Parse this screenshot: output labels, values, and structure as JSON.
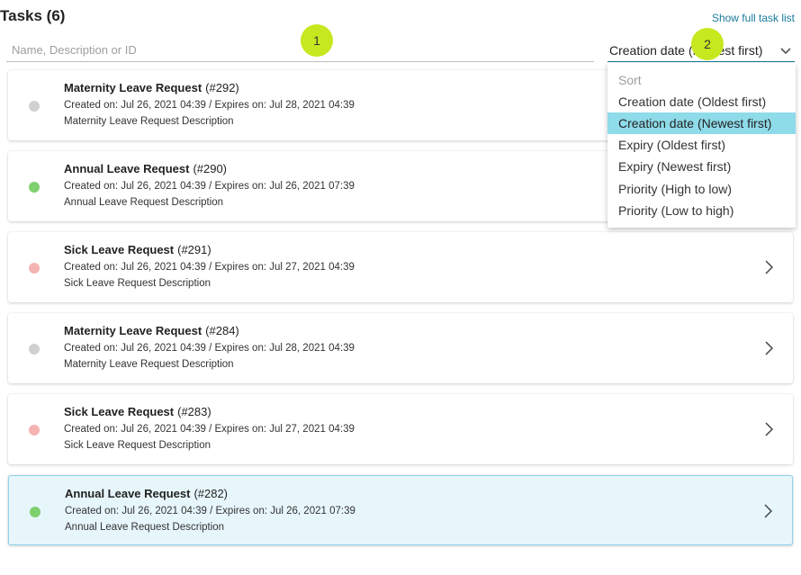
{
  "header": {
    "title": "Tasks (6)",
    "show_full_link": "Show full task list"
  },
  "search": {
    "placeholder": "Name, Description or ID",
    "value": ""
  },
  "sort": {
    "selected_label": "Creation date (Newest first)",
    "header": "Sort",
    "options": [
      "Creation date (Oldest first)",
      "Creation date (Newest first)",
      "Expiry (Oldest first)",
      "Expiry (Newest first)",
      "Priority (High to low)",
      "Priority (Low to high)"
    ],
    "active_index": 1
  },
  "markers": [
    "1",
    "2"
  ],
  "tasks": [
    {
      "name": "Maternity Leave Request",
      "id": "(#292)",
      "dates": "Created on: Jul 26, 2021 04:39 / Expires on: Jul 28, 2021 04:39",
      "description": "Maternity Leave Request Description",
      "status_color": "#d0d0d0"
    },
    {
      "name": "Annual Leave Request",
      "id": "(#290)",
      "dates": "Created on: Jul 26, 2021 04:39 / Expires on: Jul 26, 2021 07:39",
      "description": "Annual Leave Request Description",
      "status_color": "#7fd06e"
    },
    {
      "name": "Sick Leave Request",
      "id": "(#291)",
      "dates": "Created on: Jul 26, 2021 04:39 / Expires on: Jul 27, 2021 04:39",
      "description": "Sick Leave Request Description",
      "status_color": "#f5b3b3"
    },
    {
      "name": "Maternity Leave Request",
      "id": "(#284)",
      "dates": "Created on: Jul 26, 2021 04:39 / Expires on: Jul 28, 2021 04:39",
      "description": "Maternity Leave Request Description",
      "status_color": "#d0d0d0"
    },
    {
      "name": "Sick Leave Request",
      "id": "(#283)",
      "dates": "Created on: Jul 26, 2021 04:39 / Expires on: Jul 27, 2021 04:39",
      "description": "Sick Leave Request Description",
      "status_color": "#f5b3b3"
    },
    {
      "name": "Annual Leave Request",
      "id": "(#282)",
      "dates": "Created on: Jul 26, 2021 04:39 / Expires on: Jul 26, 2021 07:39",
      "description": "Annual Leave Request Description",
      "status_color": "#7fd06e"
    }
  ],
  "selected_task_index": 5,
  "icons": {
    "chevron_down": "chevron-down-icon",
    "chevron_right": "chevron-right-icon"
  }
}
